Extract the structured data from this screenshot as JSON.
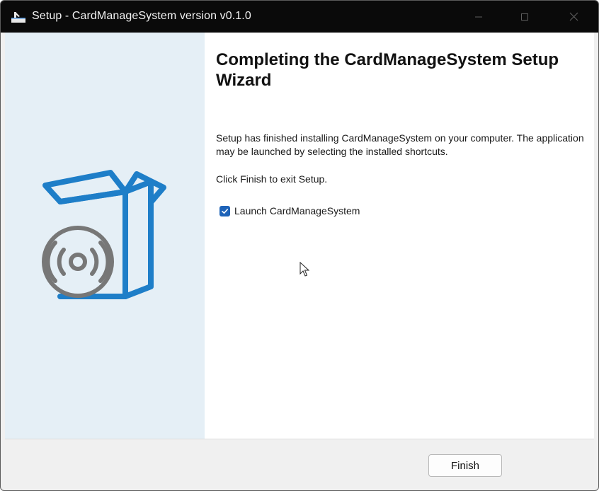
{
  "window": {
    "title": "Setup - CardManageSystem version v0.1.0"
  },
  "content": {
    "heading": "Completing the CardManageSystem Setup Wizard",
    "paragraph1": "Setup has finished installing CardManageSystem on your computer. The application may be launched by selecting the installed shortcuts.",
    "paragraph2": "Click Finish to exit Setup.",
    "launch_checkbox": {
      "label": "Launch CardManageSystem",
      "checked": true
    }
  },
  "footer": {
    "finish_label": "Finish"
  },
  "icons": {
    "app": "installer-icon",
    "minimize": "minimize-icon",
    "maximize": "maximize-icon",
    "close": "close-icon",
    "illustration": "software-box-disc-icon",
    "cursor": "mouse-cursor-icon"
  },
  "colors": {
    "titlebar": "#0a0a0a",
    "side_panel": "#e5eff6",
    "box_stroke": "#1e7ec8",
    "disc_stroke": "#777777",
    "checkbox": "#1e63b8"
  }
}
